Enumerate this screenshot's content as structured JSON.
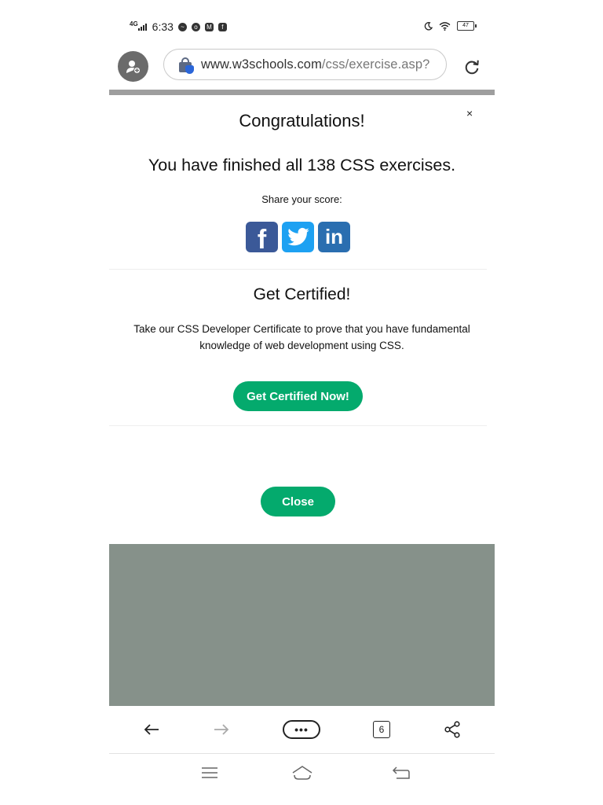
{
  "status_bar": {
    "network": "4G",
    "time": "6:33",
    "battery": "47",
    "notification_icons": [
      "messenger-icon",
      "chrome-icon",
      "mail-icon",
      "facebook-icon"
    ],
    "right_icons": [
      "moon-icon",
      "wifi-icon",
      "battery-icon"
    ]
  },
  "browser": {
    "url_domain": "www.w3schools.com",
    "url_path": "/css/exercise.asp?",
    "tab_count": "6"
  },
  "modal": {
    "close_symbol": "×",
    "title": "Congratulations!",
    "finished_text": "You have finished all 138 CSS exercises.",
    "share_label": "Share your score:",
    "social": [
      {
        "name": "facebook",
        "glyph": "f",
        "color": "#3b5998"
      },
      {
        "name": "twitter",
        "glyph": "",
        "color": "#1da1f2"
      },
      {
        "name": "linkedin",
        "glyph": "in",
        "color": "#2a6eb0"
      }
    ],
    "cert_title": "Get Certified!",
    "cert_text": "Take our CSS Developer Certificate to prove that you have fundamental knowledge of web development using CSS.",
    "cert_button": "Get Certified Now!",
    "close_button": "Close"
  },
  "toolbar": {
    "menu_label": "•••"
  },
  "colors": {
    "accent_green": "#04aa6d",
    "overlay_gray": "#86918a",
    "progress_gray": "#9e9e9e"
  }
}
